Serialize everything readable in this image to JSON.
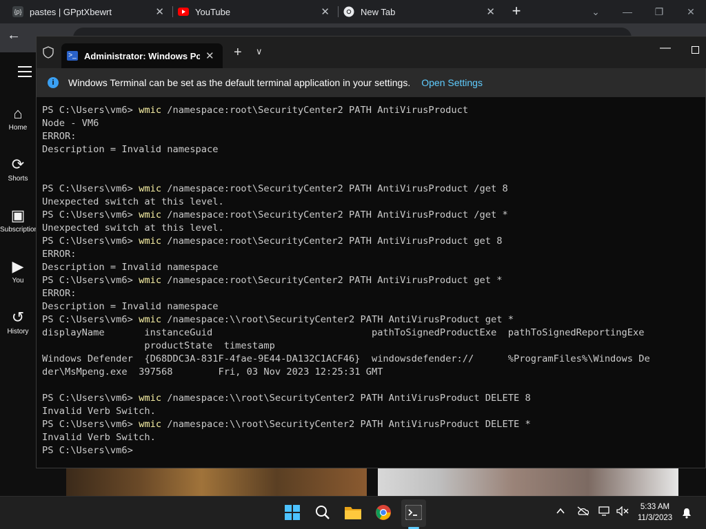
{
  "chrome": {
    "tabs": [
      {
        "favicon": "{p}",
        "title": "pastes | GPptXbewrt"
      },
      {
        "favicon": "youtube-icon",
        "title": "YouTube"
      },
      {
        "favicon": "chrome-icon",
        "title": "New Tab"
      }
    ],
    "new_tab_glyph": "+",
    "controls": {
      "minimize": "—",
      "restore": "❐",
      "close": "✕"
    }
  },
  "youtube": {
    "nav": [
      {
        "icon": "home-icon",
        "glyph": "⌂",
        "label": "Home"
      },
      {
        "icon": "shorts-icon",
        "glyph": "⟳",
        "label": "Shorts"
      },
      {
        "icon": "subscriptions-icon",
        "glyph": "▣",
        "label": "Subscriptions"
      },
      {
        "icon": "you-icon",
        "glyph": "▶",
        "label": "You"
      },
      {
        "icon": "history-icon",
        "glyph": "↺",
        "label": "History"
      }
    ]
  },
  "terminal": {
    "tab_title": "Administrator: Windows PowerShell",
    "infobar": {
      "message": "Windows Terminal can be set as the default terminal application in your settings.",
      "link": "Open Settings"
    },
    "lines": [
      {
        "p": "PS C:\\Users\\vm6> ",
        "c": "wmic",
        "r": " /namespace:root\\SecurityCenter2 PATH AntiVirusProduct"
      },
      {
        "t": "Node - VM6"
      },
      {
        "t": "ERROR:"
      },
      {
        "t": "Description = Invalid namespace"
      },
      {
        "t": ""
      },
      {
        "t": ""
      },
      {
        "p": "PS C:\\Users\\vm6> ",
        "c": "wmic",
        "r": " /namespace:root\\SecurityCenter2 PATH AntiVirusProduct /get 8"
      },
      {
        "t": "Unexpected switch at this level."
      },
      {
        "p": "PS C:\\Users\\vm6> ",
        "c": "wmic",
        "r": " /namespace:root\\SecurityCenter2 PATH AntiVirusProduct /get *"
      },
      {
        "t": "Unexpected switch at this level."
      },
      {
        "p": "PS C:\\Users\\vm6> ",
        "c": "wmic",
        "r": " /namespace:root\\SecurityCenter2 PATH AntiVirusProduct get 8"
      },
      {
        "t": "ERROR:"
      },
      {
        "t": "Description = Invalid namespace"
      },
      {
        "p": "PS C:\\Users\\vm6> ",
        "c": "wmic",
        "r": " /namespace:root\\SecurityCenter2 PATH AntiVirusProduct get *"
      },
      {
        "t": "ERROR:"
      },
      {
        "t": "Description = Invalid namespace"
      },
      {
        "p": "PS C:\\Users\\vm6> ",
        "c": "wmic",
        "r": " /namespace:\\\\root\\SecurityCenter2 PATH AntiVirusProduct get *"
      },
      {
        "t": "displayName       instanceGuid                            pathToSignedProductExe  pathToSignedReportingExe"
      },
      {
        "t": "                  productState  timestamp"
      },
      {
        "t": "Windows Defender  {D68DDC3A-831F-4fae-9E44-DA132C1ACF46}  windowsdefender://      %ProgramFiles%\\Windows De"
      },
      {
        "t": "der\\MsMpeng.exe  397568        Fri, 03 Nov 2023 12:25:31 GMT"
      },
      {
        "t": ""
      },
      {
        "p": "PS C:\\Users\\vm6> ",
        "c": "wmic",
        "r": " /namespace:\\\\root\\SecurityCenter2 PATH AntiVirusProduct DELETE 8"
      },
      {
        "t": "Invalid Verb Switch."
      },
      {
        "p": "PS C:\\Users\\vm6> ",
        "c": "wmic",
        "r": " /namespace:\\\\root\\SecurityCenter2 PATH AntiVirusProduct DELETE *"
      },
      {
        "t": "Invalid Verb Switch."
      },
      {
        "t": "PS C:\\Users\\vm6>"
      }
    ]
  },
  "taskbar": {
    "apps": [
      "start-icon",
      "search-icon",
      "file-explorer-icon",
      "chrome-icon",
      "terminal-icon"
    ],
    "tray": [
      "chevron-up-icon",
      "onedrive-icon",
      "network-icon",
      "volume-muted-icon"
    ],
    "time": "5:33 AM",
    "date": "11/3/2023"
  }
}
